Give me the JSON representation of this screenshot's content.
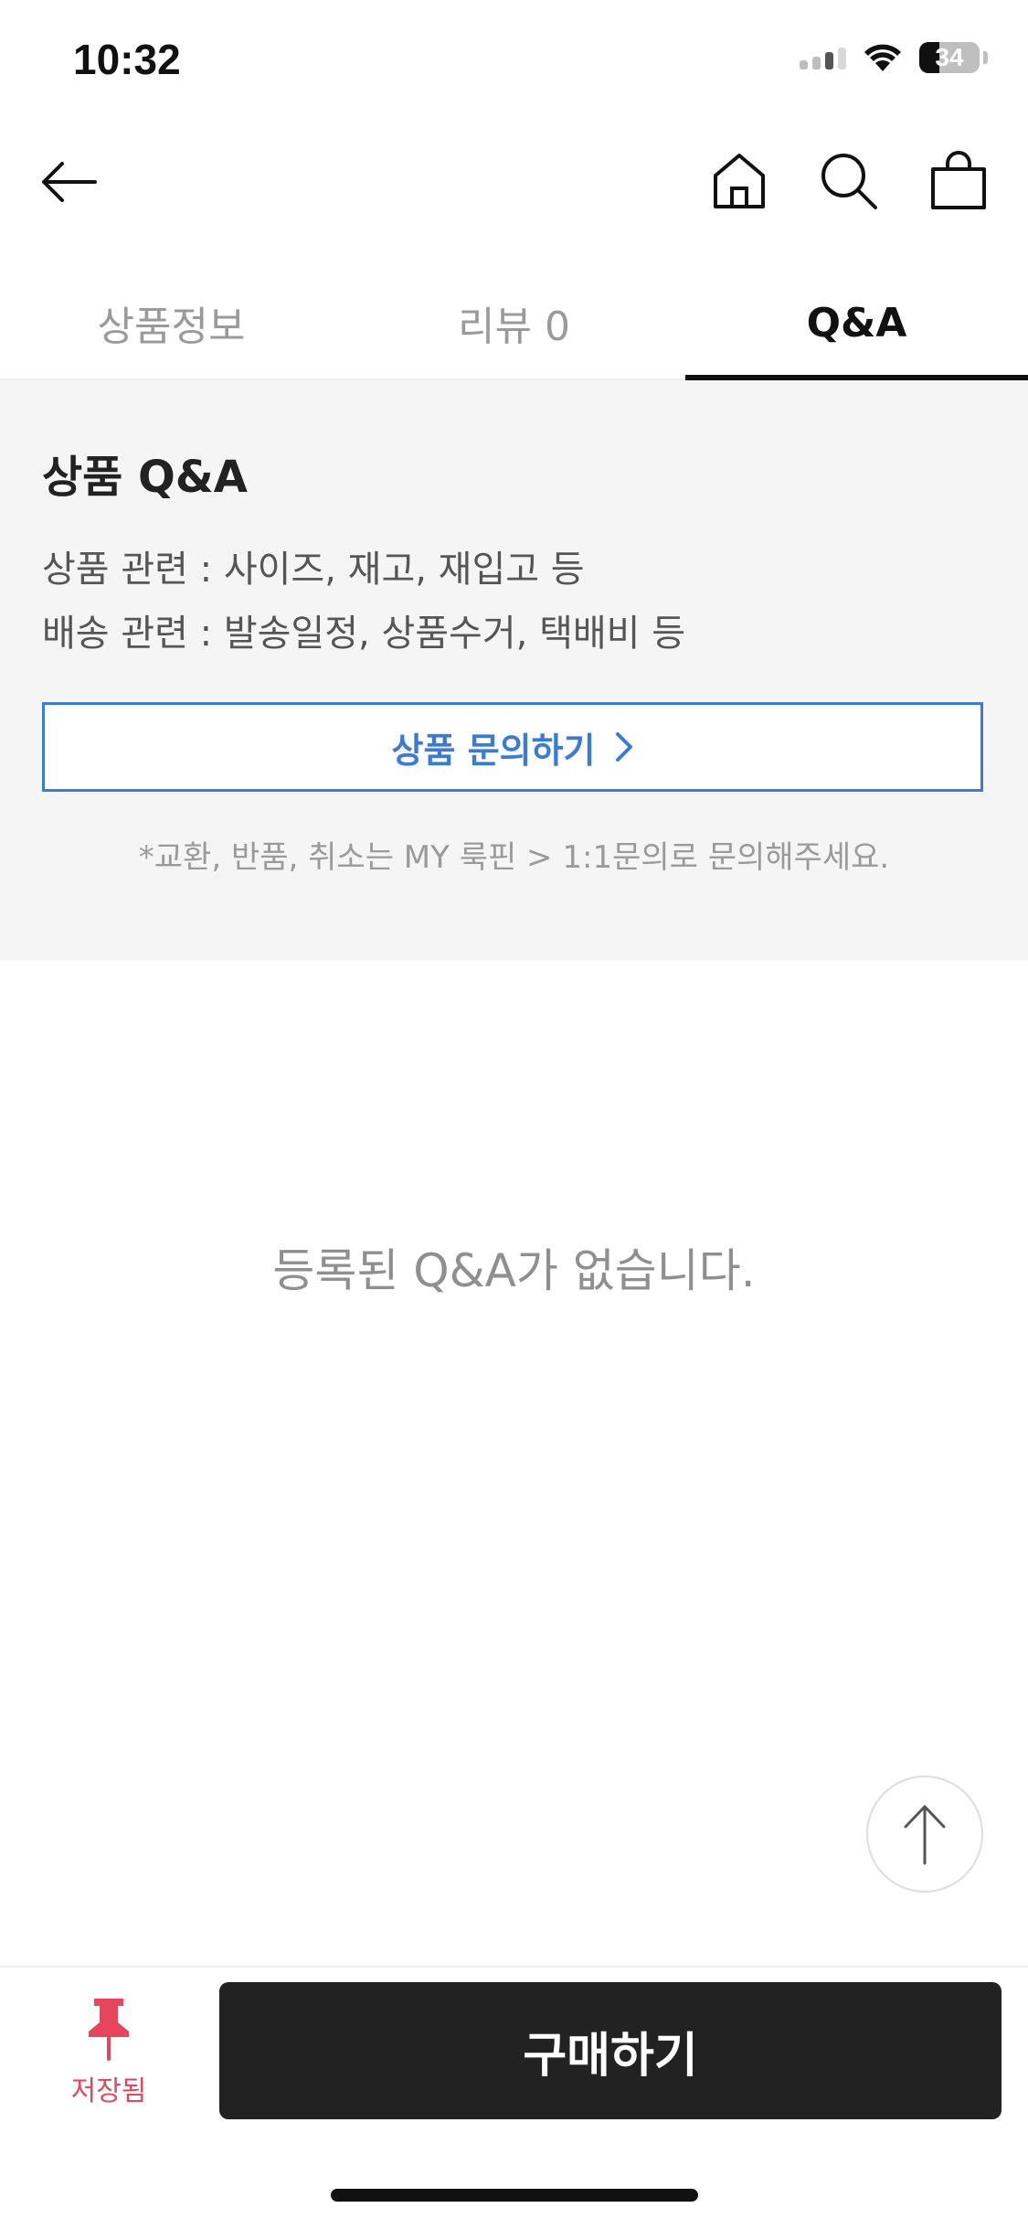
{
  "status_bar": {
    "time": "10:32",
    "battery_text": "34",
    "battery_level": 0.34
  },
  "header": {
    "back_icon": "arrow-left-icon",
    "icons": [
      "home-icon",
      "search-icon",
      "shopping-bag-icon"
    ]
  },
  "tabs": [
    {
      "label": "상품정보",
      "active": false
    },
    {
      "label": "리뷰 0",
      "active": false
    },
    {
      "label": "Q&A",
      "active": true
    }
  ],
  "qa_info": {
    "title": "상품 Q&A",
    "line1": "상품 관련 : 사이즈, 재고, 재입고 등",
    "line2": "배송 관련 : 발송일정, 상품수거, 택배비 등",
    "inquiry_button": "상품 문의하기",
    "note": "*교환, 반품, 취소는 MY 룩핀 > 1:1문의로 문의해주세요."
  },
  "empty_state": {
    "text": "등록된 Q&A가 없습니다."
  },
  "bottom_bar": {
    "save_label": "저장됨",
    "buy_label": "구매하기"
  },
  "colors": {
    "accent_blue": "#3a7bd5",
    "saved_red": "#e8455c",
    "buy_bg": "#222222",
    "info_bg": "#f5f5f5"
  }
}
